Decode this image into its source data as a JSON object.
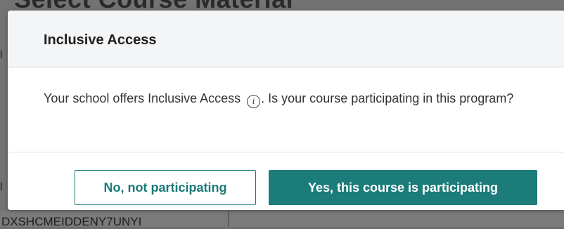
{
  "background": {
    "page_title": "Select Course Material",
    "bottom_text": "DXSHCMEIDDENY7UNYI"
  },
  "modal": {
    "title": "Inclusive Access",
    "body_before_icon": "Your school offers Inclusive Access ",
    "body_after_icon": ". Is your course participating in this program?",
    "info_icon_glyph": "i",
    "info_icon_name": "info-icon",
    "buttons": {
      "no_label": "No, not participating",
      "yes_label": "Yes, this course is participating"
    }
  },
  "colors": {
    "accent": "#1b7c79",
    "overlay": "#737373",
    "header_bg": "#f3f5f7"
  }
}
